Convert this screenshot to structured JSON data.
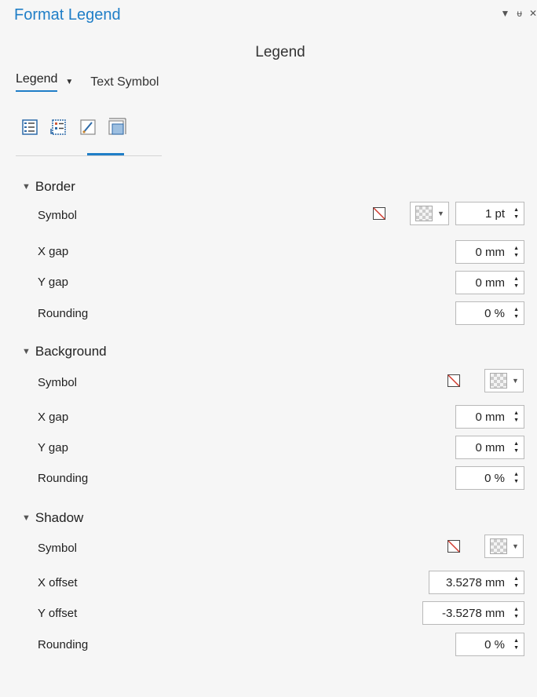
{
  "window": {
    "title": "Format Legend"
  },
  "panel": {
    "subtitle": "Legend"
  },
  "tabs": {
    "legend": "Legend",
    "text_symbol": "Text Symbol"
  },
  "icons": [
    "legend-arrangement-icon",
    "legend-items-icon",
    "display-brush-icon",
    "placement-frame-icon"
  ],
  "accent_color": "#1f7ec7",
  "border": {
    "header": "Border",
    "symbol_label": "Symbol",
    "symbol_width": "1 pt",
    "xgap_label": "X gap",
    "xgap": "0 mm",
    "ygap_label": "Y gap",
    "ygap": "0 mm",
    "rounding_label": "Rounding",
    "rounding": "0 %"
  },
  "background": {
    "header": "Background",
    "symbol_label": "Symbol",
    "xgap_label": "X gap",
    "xgap": "0 mm",
    "ygap_label": "Y gap",
    "ygap": "0 mm",
    "rounding_label": "Rounding",
    "rounding": "0 %"
  },
  "shadow": {
    "header": "Shadow",
    "symbol_label": "Symbol",
    "xoffset_label": "X offset",
    "xoffset": "3.5278 mm",
    "yoffset_label": "Y offset",
    "yoffset": "-3.5278 mm",
    "rounding_label": "Rounding",
    "rounding": "0 %"
  }
}
